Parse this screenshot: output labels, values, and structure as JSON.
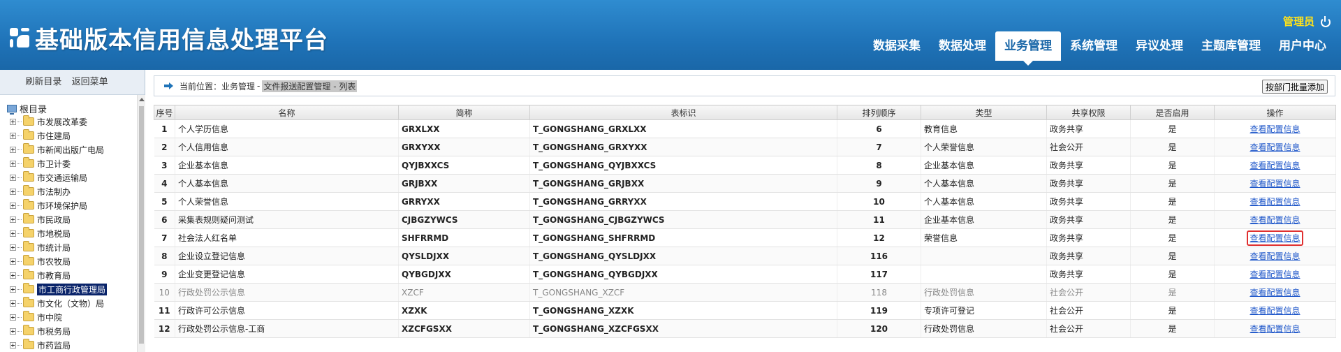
{
  "app": {
    "title": "基础版本信用信息处理平台",
    "user": "管理员"
  },
  "nav": [
    {
      "label": "数据采集",
      "active": false
    },
    {
      "label": "数据处理",
      "active": false
    },
    {
      "label": "业务管理",
      "active": true
    },
    {
      "label": "系统管理",
      "active": false
    },
    {
      "label": "异议处理",
      "active": false
    },
    {
      "label": "主题库管理",
      "active": false
    },
    {
      "label": "用户中心",
      "active": false
    }
  ],
  "sidebar": {
    "refresh": "刷新目录",
    "back": "返回菜单",
    "root": "根目录",
    "items": [
      {
        "label": "市发展改革委",
        "selected": false
      },
      {
        "label": "市住建局",
        "selected": false
      },
      {
        "label": "市新闻出版广电局",
        "selected": false
      },
      {
        "label": "市卫计委",
        "selected": false
      },
      {
        "label": "市交通运输局",
        "selected": false
      },
      {
        "label": "市法制办",
        "selected": false
      },
      {
        "label": "市环境保护局",
        "selected": false
      },
      {
        "label": "市民政局",
        "selected": false
      },
      {
        "label": "市地税局",
        "selected": false
      },
      {
        "label": "市统计局",
        "selected": false
      },
      {
        "label": "市农牧局",
        "selected": false
      },
      {
        "label": "市教育局",
        "selected": false
      },
      {
        "label": "市工商行政管理局",
        "selected": true
      },
      {
        "label": "市文化（文物）局",
        "selected": false
      },
      {
        "label": "市中院",
        "selected": false
      },
      {
        "label": "市税务局",
        "selected": false
      },
      {
        "label": "市药监局",
        "selected": false
      }
    ]
  },
  "breadcrumb": {
    "prefix": "当前位置：",
    "level1": "业务管理",
    "sep": "-",
    "level2": "文件报送配置管理 - 列表"
  },
  "batch_button": "按部门批量添加",
  "table": {
    "headers": [
      "序号",
      "名称",
      "简称",
      "表标识",
      "排列顺序",
      "类型",
      "共享权限",
      "是否启用",
      "操作"
    ],
    "rows": [
      {
        "no": "1",
        "name": "个人学历信息",
        "abbr": "GRXLXX",
        "id": "T_GONGSHANG_GRXLXX",
        "order": "6",
        "type": "教育信息",
        "share": "政务共享",
        "enabled": "是",
        "action": "查看配置信息",
        "light": false,
        "highlight": false
      },
      {
        "no": "2",
        "name": "个人信用信息",
        "abbr": "GRXYXX",
        "id": "T_GONGSHANG_GRXYXX",
        "order": "7",
        "type": "个人荣誉信息",
        "share": "社会公开",
        "enabled": "是",
        "action": "查看配置信息",
        "light": false,
        "highlight": false
      },
      {
        "no": "3",
        "name": "企业基本信息",
        "abbr": "QYJBXXCS",
        "id": "T_GONGSHANG_QYJBXXCS",
        "order": "8",
        "type": "企业基本信息",
        "share": "政务共享",
        "enabled": "是",
        "action": "查看配置信息",
        "light": false,
        "highlight": false
      },
      {
        "no": "4",
        "name": "个人基本信息",
        "abbr": "GRJBXX",
        "id": "T_GONGSHANG_GRJBXX",
        "order": "9",
        "type": "个人基本信息",
        "share": "政务共享",
        "enabled": "是",
        "action": "查看配置信息",
        "light": false,
        "highlight": false
      },
      {
        "no": "5",
        "name": "个人荣誉信息",
        "abbr": "GRRYXX",
        "id": "T_GONGSHANG_GRRYXX",
        "order": "10",
        "type": "个人基本信息",
        "share": "政务共享",
        "enabled": "是",
        "action": "查看配置信息",
        "light": false,
        "highlight": false
      },
      {
        "no": "6",
        "name": "采集表规则疑问测试",
        "abbr": "CJBGZYWCS",
        "id": "T_GONGSHANG_CJBGZYWCS",
        "order": "11",
        "type": "企业基本信息",
        "share": "政务共享",
        "enabled": "是",
        "action": "查看配置信息",
        "light": false,
        "highlight": false
      },
      {
        "no": "7",
        "name": "社会法人红名单",
        "abbr": "SHFRRMD",
        "id": "T_GONGSHANG_SHFRRMD",
        "order": "12",
        "type": "荣誉信息",
        "share": "政务共享",
        "enabled": "是",
        "action": "查看配置信息",
        "light": false,
        "highlight": true
      },
      {
        "no": "8",
        "name": "企业设立登记信息",
        "abbr": "QYSLDJXX",
        "id": "T_GONGSHANG_QYSLDJXX",
        "order": "116",
        "type": "",
        "share": "政务共享",
        "enabled": "是",
        "action": "查看配置信息",
        "light": false,
        "highlight": false
      },
      {
        "no": "9",
        "name": "企业变更登记信息",
        "abbr": "QYBGDJXX",
        "id": "T_GONGSHANG_QYBGDJXX",
        "order": "117",
        "type": "",
        "share": "政务共享",
        "enabled": "是",
        "action": "查看配置信息",
        "light": false,
        "highlight": false
      },
      {
        "no": "10",
        "name": "行政处罚公示信息",
        "abbr": "XZCF",
        "id": "T_GONGSHANG_XZCF",
        "order": "118",
        "type": "行政处罚信息",
        "share": "社会公开",
        "enabled": "是",
        "action": "查看配置信息",
        "light": true,
        "highlight": false
      },
      {
        "no": "11",
        "name": "行政许可公示信息",
        "abbr": "XZXK",
        "id": "T_GONGSHANG_XZXK",
        "order": "119",
        "type": "专项许可登记",
        "share": "社会公开",
        "enabled": "是",
        "action": "查看配置信息",
        "light": false,
        "highlight": false
      },
      {
        "no": "12",
        "name": "行政处罚公示信息-工商",
        "abbr": "XZCFGSXX",
        "id": "T_GONGSHANG_XZCFGSXX",
        "order": "120",
        "type": "行政处罚信息",
        "share": "社会公开",
        "enabled": "是",
        "action": "查看配置信息",
        "light": false,
        "highlight": false
      }
    ]
  }
}
